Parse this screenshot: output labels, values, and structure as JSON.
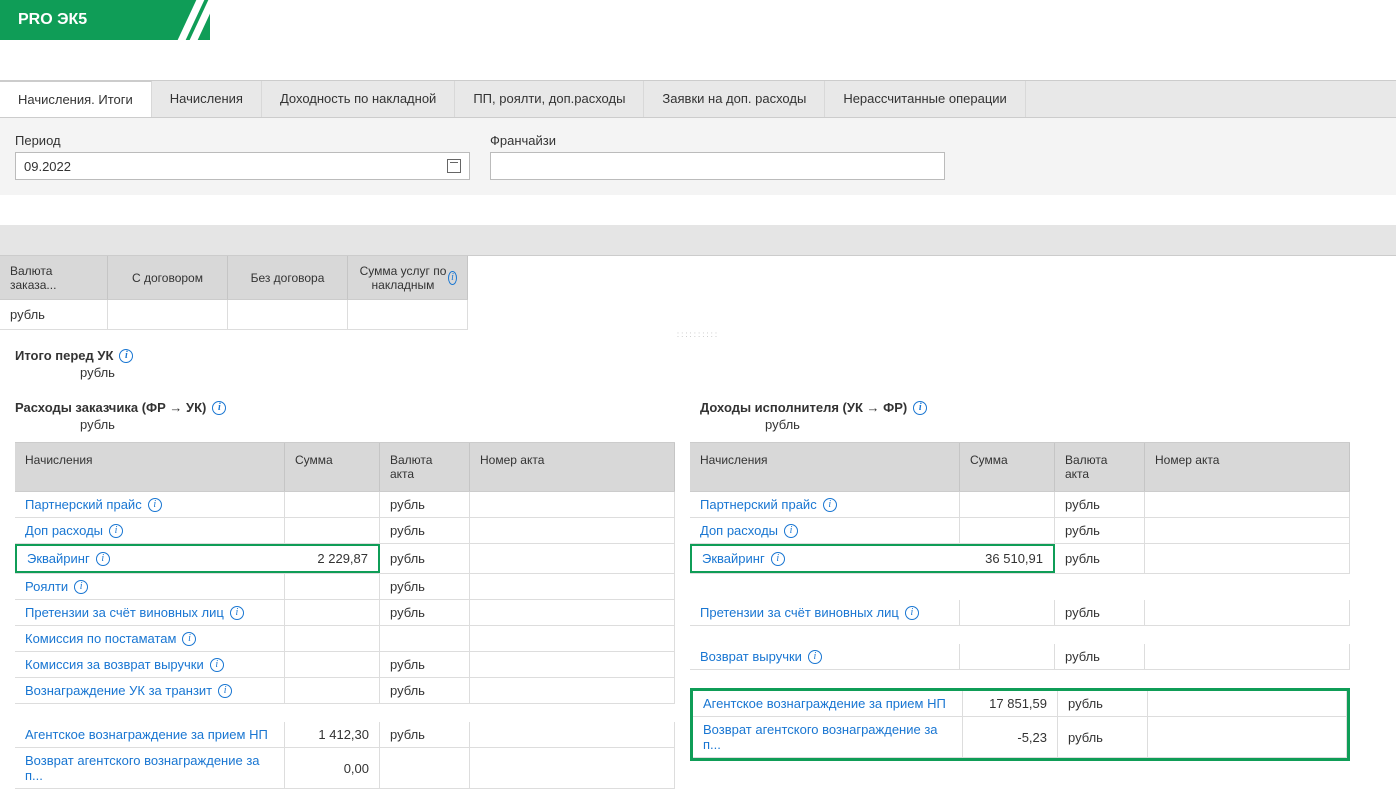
{
  "header": {
    "title": "PRO ЭК5"
  },
  "tabs": [
    {
      "label": "Начисления. Итоги",
      "active": true
    },
    {
      "label": "Начисления"
    },
    {
      "label": "Доходность по накладной"
    },
    {
      "label": "ПП, роялти, доп.расходы"
    },
    {
      "label": "Заявки на доп. расходы"
    },
    {
      "label": "Нерассчитанные операции"
    }
  ],
  "filters": {
    "period_label": "Период",
    "period_value": "09.2022",
    "franchise_label": "Франчайзи"
  },
  "top_table": {
    "headers": [
      "Валюта заказа...",
      "С договором",
      "Без договора",
      "Сумма услуг по накладным"
    ],
    "row": [
      "рубль",
      "",
      "",
      ""
    ]
  },
  "sections": {
    "total_title": "Итого перед УК",
    "total_currency": "рубль",
    "expenses_title": "Расходы заказчика (ФР → УК)",
    "expenses_currency": "рубль",
    "income_title": "Доходы исполнителя (УК → ФР)",
    "income_currency": "рубль"
  },
  "table_headers": {
    "c1": "Начисления",
    "c2": "Сумма",
    "c3": "Валюта акта",
    "c4": "Номер акта"
  },
  "left_rows_a": [
    {
      "name": "Партнерский прайс",
      "info": true,
      "sum": "",
      "currency": "рубль"
    },
    {
      "name": "Доп расходы",
      "info": true,
      "sum": "",
      "currency": "рубль"
    },
    {
      "name": "Эквайринг",
      "info": true,
      "sum": "2 229,87",
      "currency": "рубль",
      "highlight": true
    },
    {
      "name": "Роялти",
      "info": true,
      "sum": "",
      "currency": "рубль"
    },
    {
      "name": "Претензии за счёт виновных лиц",
      "info": true,
      "sum": "",
      "currency": "рубль"
    },
    {
      "name": "Комиссия по постаматам",
      "info": true,
      "sum": "",
      "currency": ""
    },
    {
      "name": "Комиссия за возврат выручки",
      "info": true,
      "sum": "",
      "currency": "рубль"
    },
    {
      "name": "Вознаграждение УК за транзит",
      "info": true,
      "sum": "",
      "currency": "рубль"
    }
  ],
  "left_rows_b": [
    {
      "name": "Агентское вознаграждение за прием НП",
      "sum": "1 412,30",
      "currency": "рубль"
    },
    {
      "name": "Возврат агентского вознаграждение за п...",
      "sum": "0,00",
      "currency": ""
    }
  ],
  "right_rows_a": [
    {
      "name": "Партнерский прайс",
      "info": true,
      "sum": "",
      "currency": "рубль"
    },
    {
      "name": "Доп расходы",
      "info": true,
      "sum": "",
      "currency": "рубль"
    },
    {
      "name": "Эквайринг",
      "info": true,
      "sum": "36 510,91",
      "currency": "рубль",
      "highlight": true
    },
    {
      "name": "",
      "blank": true
    },
    {
      "name": "Претензии за счёт виновных лиц",
      "info": true,
      "sum": "",
      "currency": "рубль"
    }
  ],
  "right_rows_b": [
    {
      "name": "Возврат выручки",
      "info": true,
      "sum": "",
      "currency": "рубль"
    }
  ],
  "right_rows_c": [
    {
      "name": "Агентское вознаграждение за прием НП",
      "sum": "17 851,59",
      "currency": "рубль"
    },
    {
      "name": "Возврат агентского вознаграждение за п...",
      "sum": "-5,23",
      "currency": "рубль"
    }
  ]
}
